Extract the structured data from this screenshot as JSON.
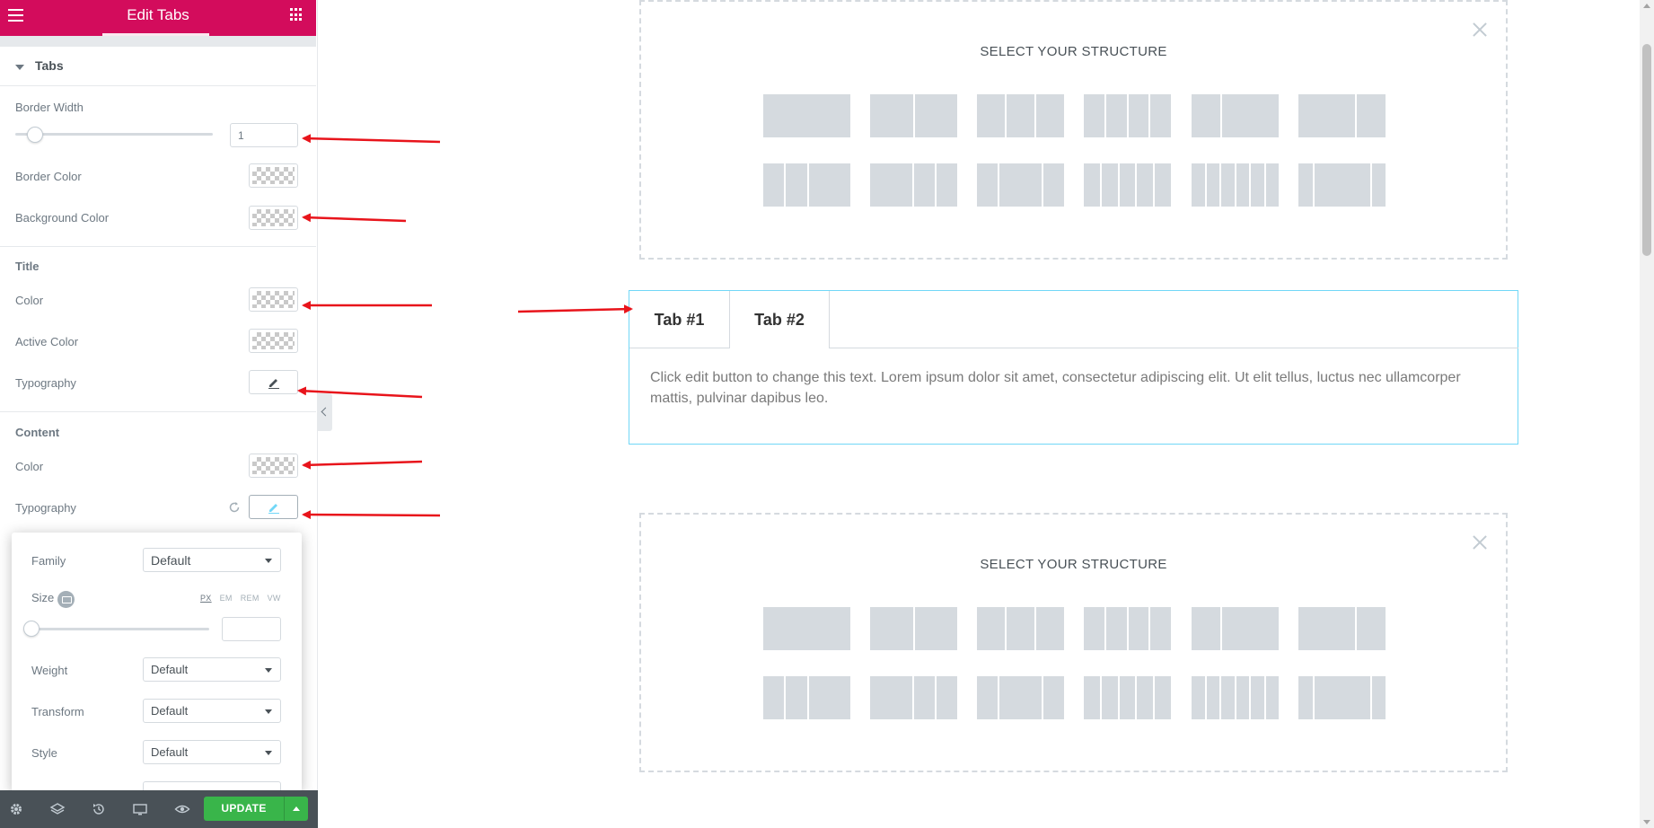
{
  "panel": {
    "header_title": "Edit Tabs",
    "section_title": "Tabs",
    "border_width_label": "Border Width",
    "border_width_value": "1",
    "border_width_fraction": 0.1,
    "border_color_label": "Border Color",
    "background_color_label": "Background Color",
    "title_group": "Title",
    "title_color_label": "Color",
    "title_active_color_label": "Active Color",
    "title_typography_label": "Typography",
    "content_group": "Content",
    "content_color_label": "Color",
    "content_typography_label": "Typography"
  },
  "typography_popover": {
    "family_label": "Family",
    "family_value": "Default",
    "size_label": "Size",
    "size_units": [
      "PX",
      "EM",
      "REM",
      "VW"
    ],
    "size_selected_unit": "PX",
    "size_value": "",
    "weight_label": "Weight",
    "weight_value": "Default",
    "transform_label": "Transform",
    "transform_value": "Default",
    "style_label": "Style",
    "style_value": "Default"
  },
  "toolbar": {
    "update_label": "UPDATE",
    "icons": [
      "settings-icon",
      "layers-icon",
      "history-icon",
      "responsive-icon",
      "preview-icon"
    ]
  },
  "canvas": {
    "structure_heading_top": "SELECT YOUR STRUCTURE",
    "structure_heading_bottom": "SELECT YOUR STRUCTURE",
    "tabs": [
      "Tab #1",
      "Tab #2"
    ],
    "tab_content": "Click edit button to change this text. Lorem ipsum dolor sit amet, consectetur adipiscing elit. Ut elit tellus, luctus nec ullamcorper mattis, pulvinar dapibus leo."
  },
  "colors": {
    "header_bg": "#d30c5c",
    "update_green": "#39b54a",
    "toolbar_bg": "#495157",
    "annotation_red": "#e8141b",
    "tabs_border": "#71d7f7"
  }
}
